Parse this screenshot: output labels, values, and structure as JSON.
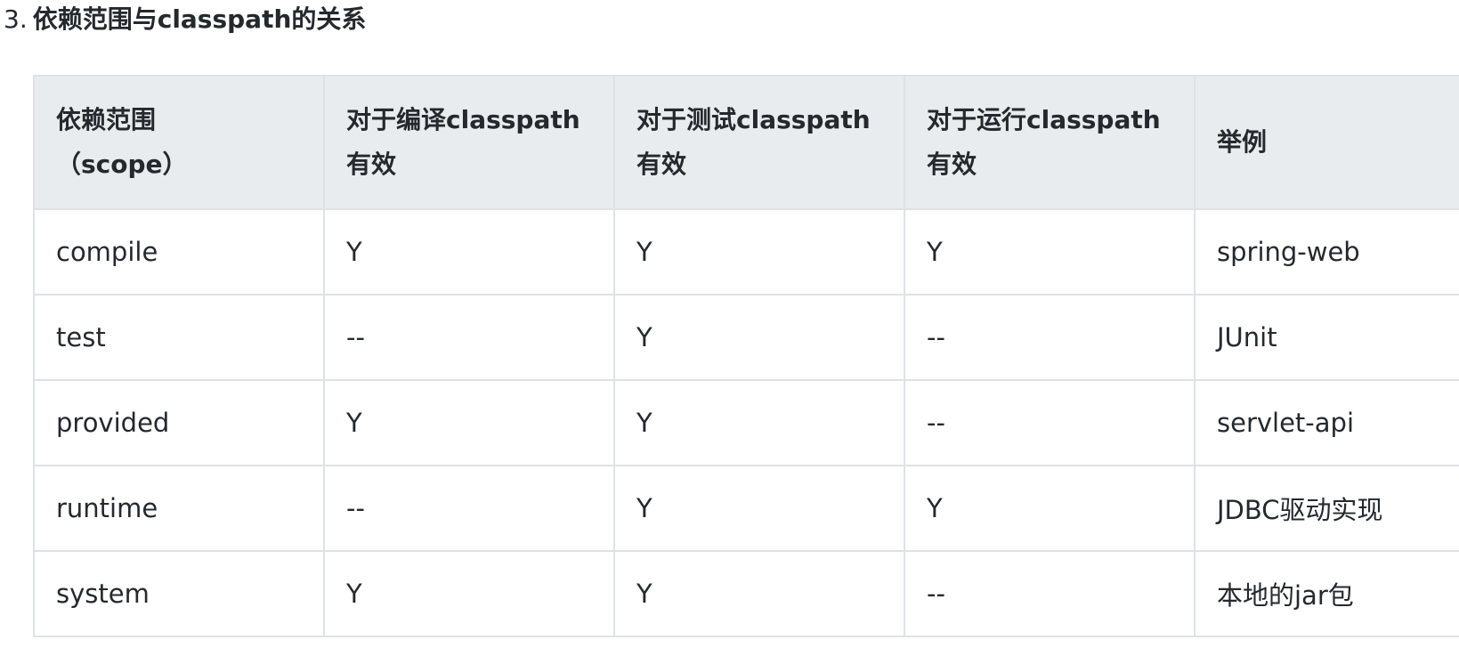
{
  "heading": {
    "number": "3.",
    "title": "依赖范围与classpath的关系"
  },
  "table": {
    "headers": [
      {
        "line1": "依赖范围",
        "line2": "（scope）"
      },
      {
        "line1": "对于编译classpath",
        "line2": "有效"
      },
      {
        "line1": "对于测试classpath",
        "line2": "有效"
      },
      {
        "line1": "对于运行classpath",
        "line2": "有效"
      },
      {
        "line1": "举例",
        "line2": ""
      }
    ],
    "rows": [
      [
        "compile",
        "Y",
        "Y",
        "Y",
        "spring-web"
      ],
      [
        "test",
        "--",
        "Y",
        "--",
        "JUnit"
      ],
      [
        "provided",
        "Y",
        "Y",
        "--",
        "servlet-api"
      ],
      [
        "runtime",
        "--",
        "Y",
        "Y",
        "JDBC驱动实现"
      ],
      [
        "system",
        "Y",
        "Y",
        "--",
        "本地的jar包"
      ]
    ]
  }
}
